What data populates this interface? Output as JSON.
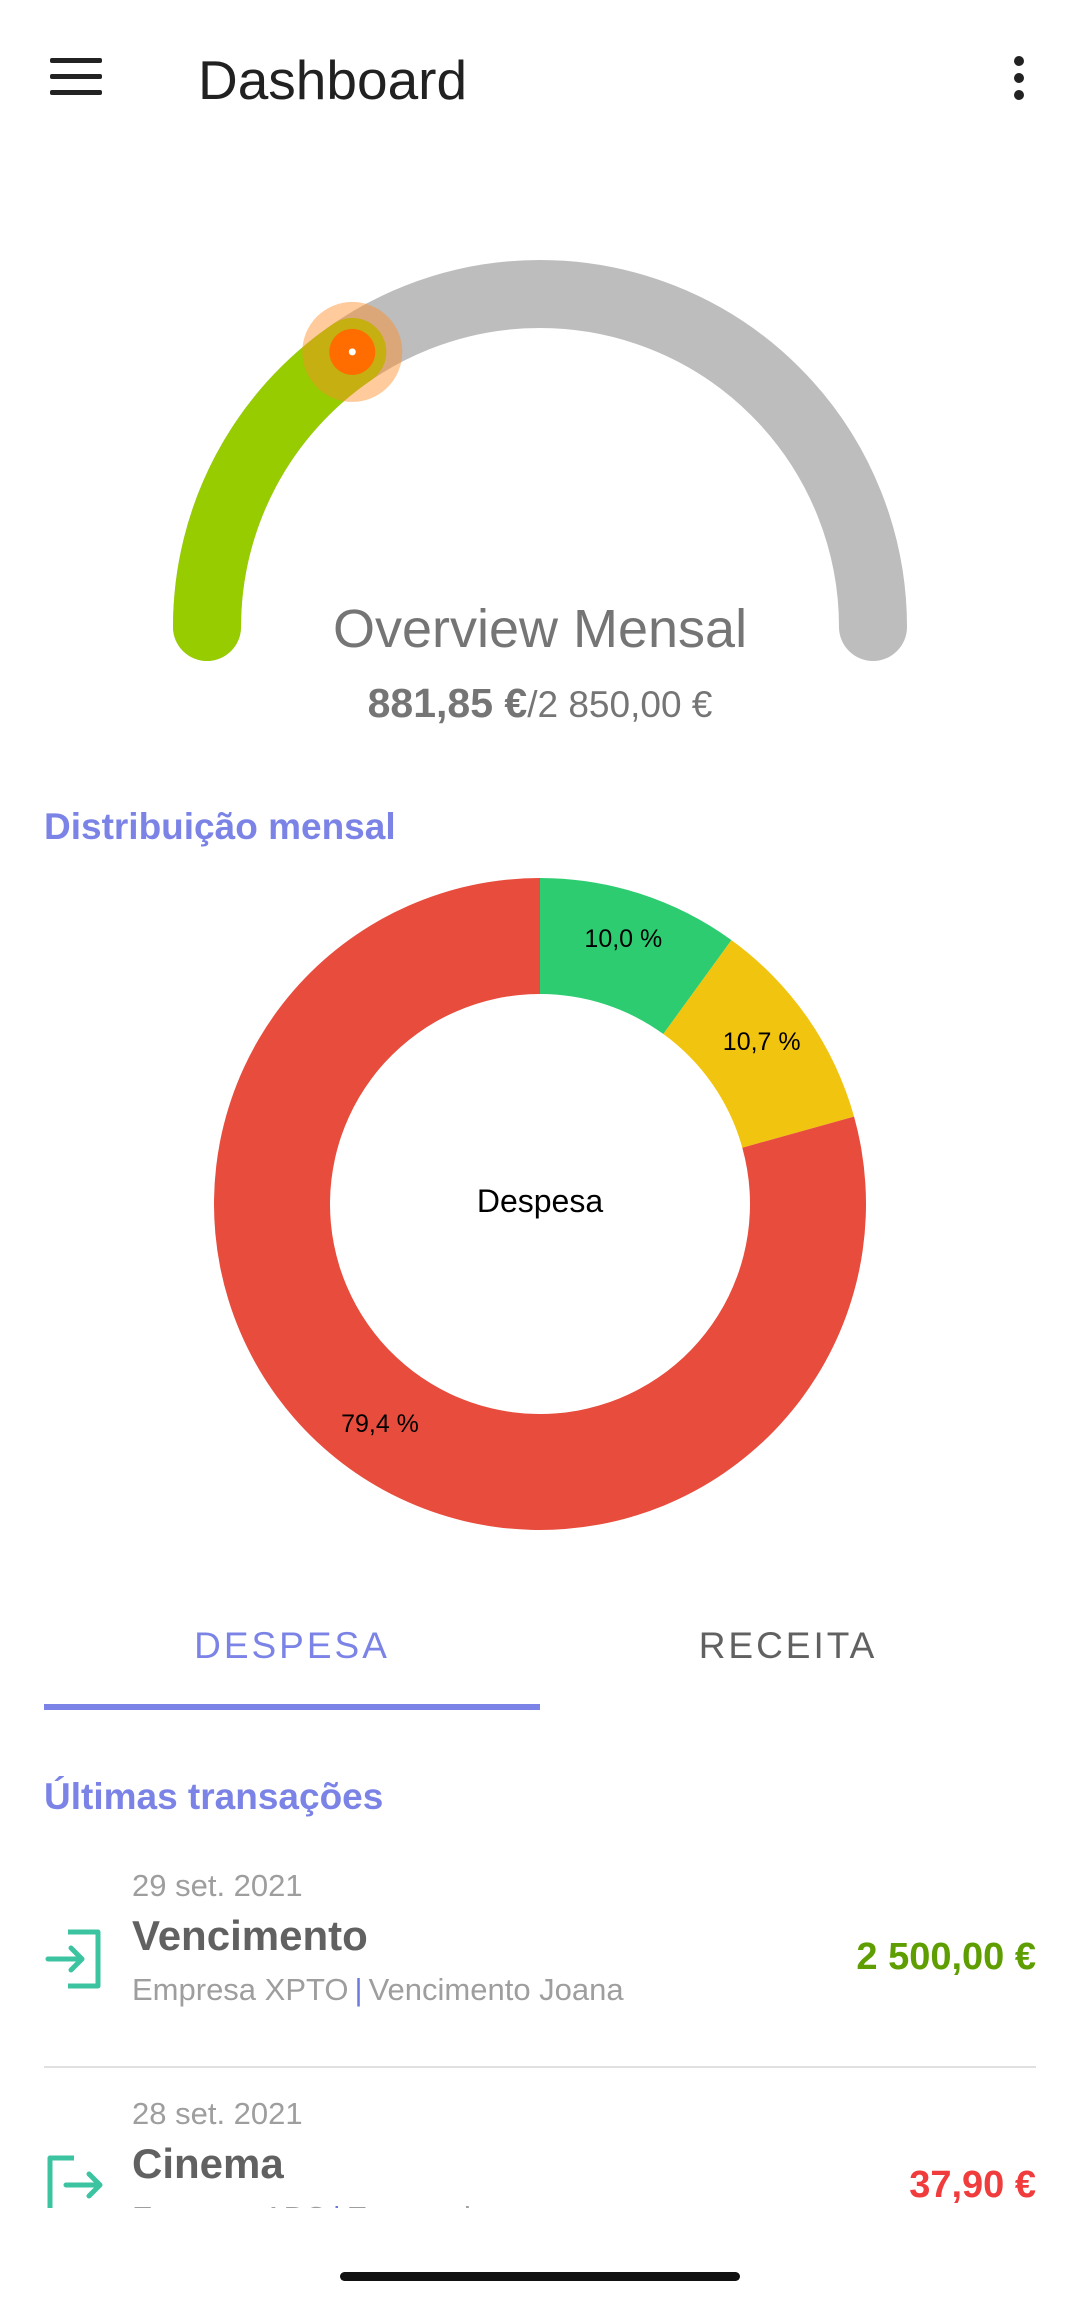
{
  "appbar": {
    "title": "Dashboard",
    "menu_icon": "hamburger-menu-icon",
    "more_icon": "more-vert-icon"
  },
  "overview": {
    "title": "Overview Mensal",
    "spent": "881,85 €",
    "total": "/2 850,00 €",
    "progress": 0.3094,
    "colors": {
      "progress": "#96cc00",
      "track": "#bdbdbd",
      "thumb": "#ff6d00"
    }
  },
  "distribution": {
    "label": "Distribuição mensal",
    "chart_data": {
      "type": "pie",
      "center_label": "Despesa",
      "slices": [
        {
          "value": 10.0,
          "label": "10,0 %",
          "color": "#2ecc71"
        },
        {
          "value": 10.7,
          "label": "10,7 %",
          "color": "#f1c40f"
        },
        {
          "value": 79.4,
          "label": "79,4 %",
          "color": "#e74c3c"
        }
      ]
    }
  },
  "tabs": [
    {
      "label": "DESPESA",
      "active": true
    },
    {
      "label": "RECEITA",
      "active": false
    }
  ],
  "transactions": {
    "label": "Últimas transações",
    "items": [
      {
        "date": "29 set. 2021",
        "name": "Vencimento",
        "entity": "Empresa XPTO",
        "description": "Vencimento Joana",
        "amount": "2 500,00 €",
        "amount_color": "#5e9e00",
        "icon": "login-arrow-icon"
      },
      {
        "date": "28 set. 2021",
        "name": "Cinema",
        "entity": "Empresa ABC",
        "description": "Entretenimento",
        "amount": "37,90 €",
        "amount_color": "#f03c3c",
        "icon": "logout-arrow-icon"
      }
    ]
  }
}
